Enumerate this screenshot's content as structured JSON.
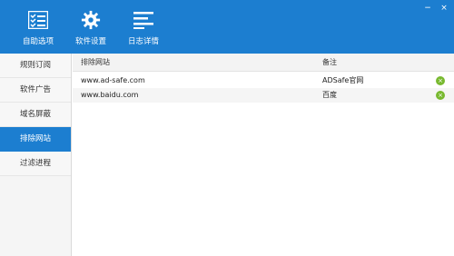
{
  "window": {
    "controls": {
      "minimize": "−",
      "close": "×"
    }
  },
  "toolbar": {
    "items": [
      {
        "label": "自助选项",
        "icon": "checklist-icon"
      },
      {
        "label": "软件设置",
        "icon": "gear-icon"
      },
      {
        "label": "日志详情",
        "icon": "log-lines-icon"
      }
    ]
  },
  "sidebar": {
    "items": [
      {
        "label": "规则订阅",
        "active": false
      },
      {
        "label": "软件广告",
        "active": false
      },
      {
        "label": "域名屏蔽",
        "active": false
      },
      {
        "label": "排除网站",
        "active": true
      },
      {
        "label": "过滤进程",
        "active": false
      }
    ]
  },
  "table": {
    "headers": {
      "site": "排除网站",
      "note": "备注"
    },
    "rows": [
      {
        "site": "www.ad-safe.com",
        "note": "ADSafe官网"
      },
      {
        "site": "www.baidu.com",
        "note": "百度"
      }
    ],
    "delete_icon": "×"
  },
  "colors": {
    "accent": "#1c7ed0",
    "delete": "#78b92f"
  }
}
